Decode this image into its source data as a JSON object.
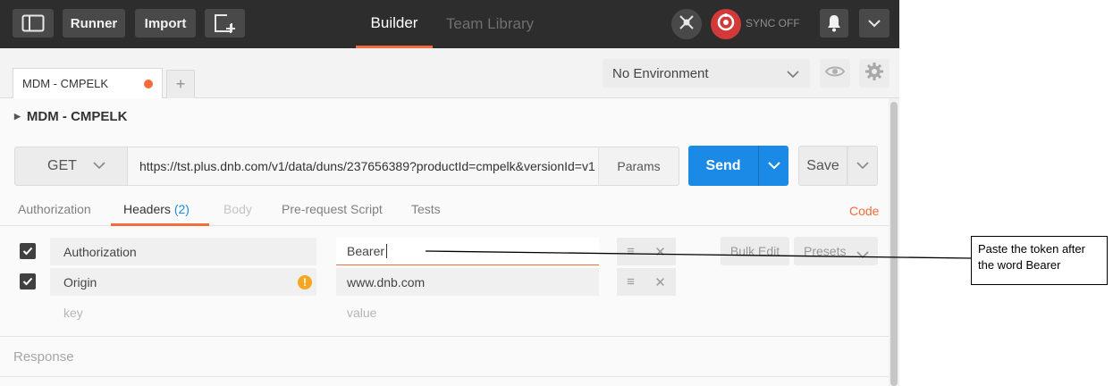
{
  "topbar": {
    "runner_label": "Runner",
    "import_label": "Import",
    "builder_tab": "Builder",
    "team_library_tab": "Team Library",
    "sync_label": "SYNC OFF",
    "colors": {
      "background": "#2d2d2d",
      "accent": "#f26b3a",
      "sync_red": "#e23c3c"
    }
  },
  "tabs": {
    "request_tab_label": "MDM - CMPELK",
    "add_tab_label": "+"
  },
  "environment": {
    "selected": "No Environment"
  },
  "collection": {
    "name": "MDM - CMPELK"
  },
  "request": {
    "method": "GET",
    "url": "https://tst.plus.dnb.com/v1/data/duns/237656389?productId=cmpelk&versionId=v1",
    "params_label": "Params",
    "send_label": "Send",
    "save_label": "Save"
  },
  "subtabs": {
    "authorization": "Authorization",
    "headers": "Headers",
    "headers_count": "(2)",
    "body": "Body",
    "prerequest": "Pre-request Script",
    "tests": "Tests",
    "code": "Code"
  },
  "headers": {
    "rows": [
      {
        "key": "Authorization",
        "value": "Bearer",
        "checked": true
      },
      {
        "key": "Origin",
        "value": "www.dnb.com",
        "checked": true
      }
    ],
    "key_placeholder": "key",
    "value_placeholder": "value",
    "bulk_edit_label": "Bulk Edit",
    "presets_label": "Presets"
  },
  "response": {
    "label": "Response"
  },
  "annotation": {
    "line1": "Paste the token after",
    "line2": "the word Bearer"
  }
}
